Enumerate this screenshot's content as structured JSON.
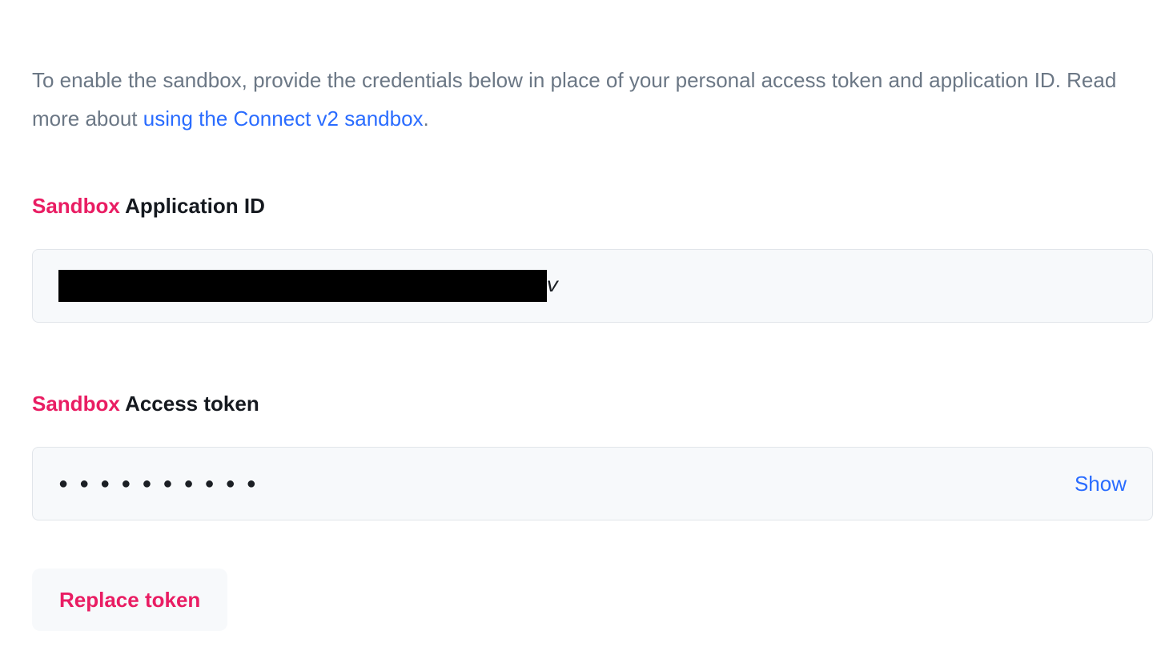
{
  "intro": {
    "text_before_link": "To enable the sandbox, provide the credentials below in place of your personal access token and application ID. Read more about ",
    "link_text": "using the Connect v2 sandbox",
    "text_after_link": "."
  },
  "sections": {
    "app_id": {
      "prefix": "Sandbox",
      "label": "Application ID",
      "value_trailing_char": "v"
    },
    "access_token": {
      "prefix": "Sandbox",
      "label": "Access token",
      "masked_value": "●●●●●●●●●●",
      "show_label": "Show"
    }
  },
  "actions": {
    "replace_token": "Replace token"
  },
  "colors": {
    "accent_pink": "#e91d63",
    "link_blue": "#2a6cff",
    "muted_text": "#6b7785",
    "field_bg": "#f7f9fb",
    "field_border": "#e1e5ea"
  }
}
